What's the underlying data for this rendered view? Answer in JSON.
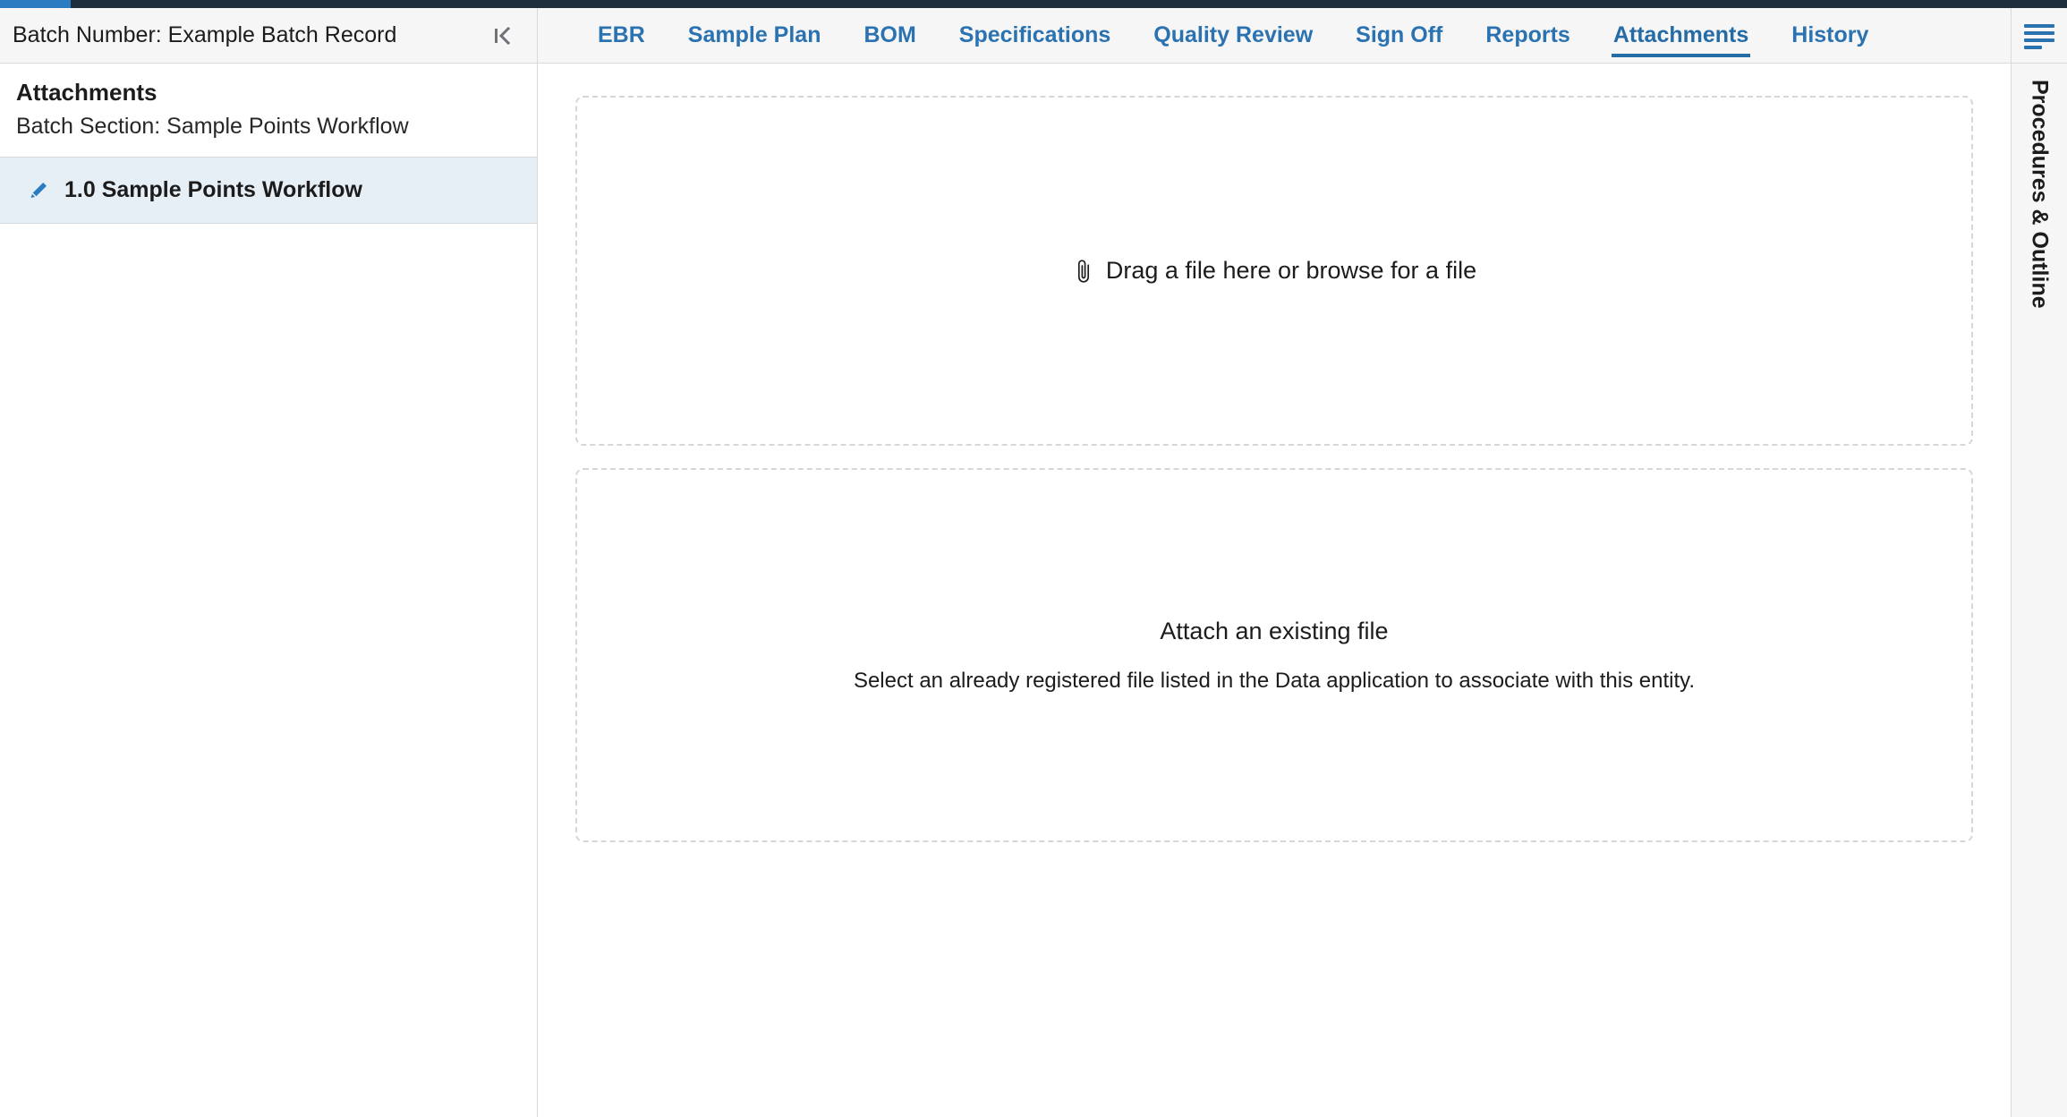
{
  "top_bar": {
    "progress_percent": 3.4,
    "fill_color": "#2b7cc0",
    "track_color": "#1e2d3b"
  },
  "header": {
    "batch_title": "Batch Number: Example Batch Record",
    "collapse_icon": "collapse-panel-left-icon",
    "menu_icon": "hamburger-menu-icon",
    "accent_color": "#2b72b0"
  },
  "tabs": [
    {
      "label": "EBR",
      "active": false
    },
    {
      "label": "Sample Plan",
      "active": false
    },
    {
      "label": "BOM",
      "active": false
    },
    {
      "label": "Specifications",
      "active": false
    },
    {
      "label": "Quality Review",
      "active": false
    },
    {
      "label": "Sign Off",
      "active": false
    },
    {
      "label": "Reports",
      "active": false
    },
    {
      "label": "Attachments",
      "active": true
    },
    {
      "label": "History",
      "active": false
    }
  ],
  "sidebar": {
    "title": "Attachments",
    "subtitle": "Batch Section: Sample Points Workflow",
    "items": [
      {
        "label": "1.0 Sample Points Workflow",
        "icon": "pencil-icon",
        "selected": true
      }
    ]
  },
  "right_rail": {
    "label": "Procedures & Outline"
  },
  "main": {
    "upload_zone": {
      "icon": "paperclip-icon",
      "text": "Drag a file here or browse for a file"
    },
    "existing_zone": {
      "title": "Attach an existing file",
      "description": "Select an already registered file listed in the Data application to associate with this entity."
    }
  }
}
